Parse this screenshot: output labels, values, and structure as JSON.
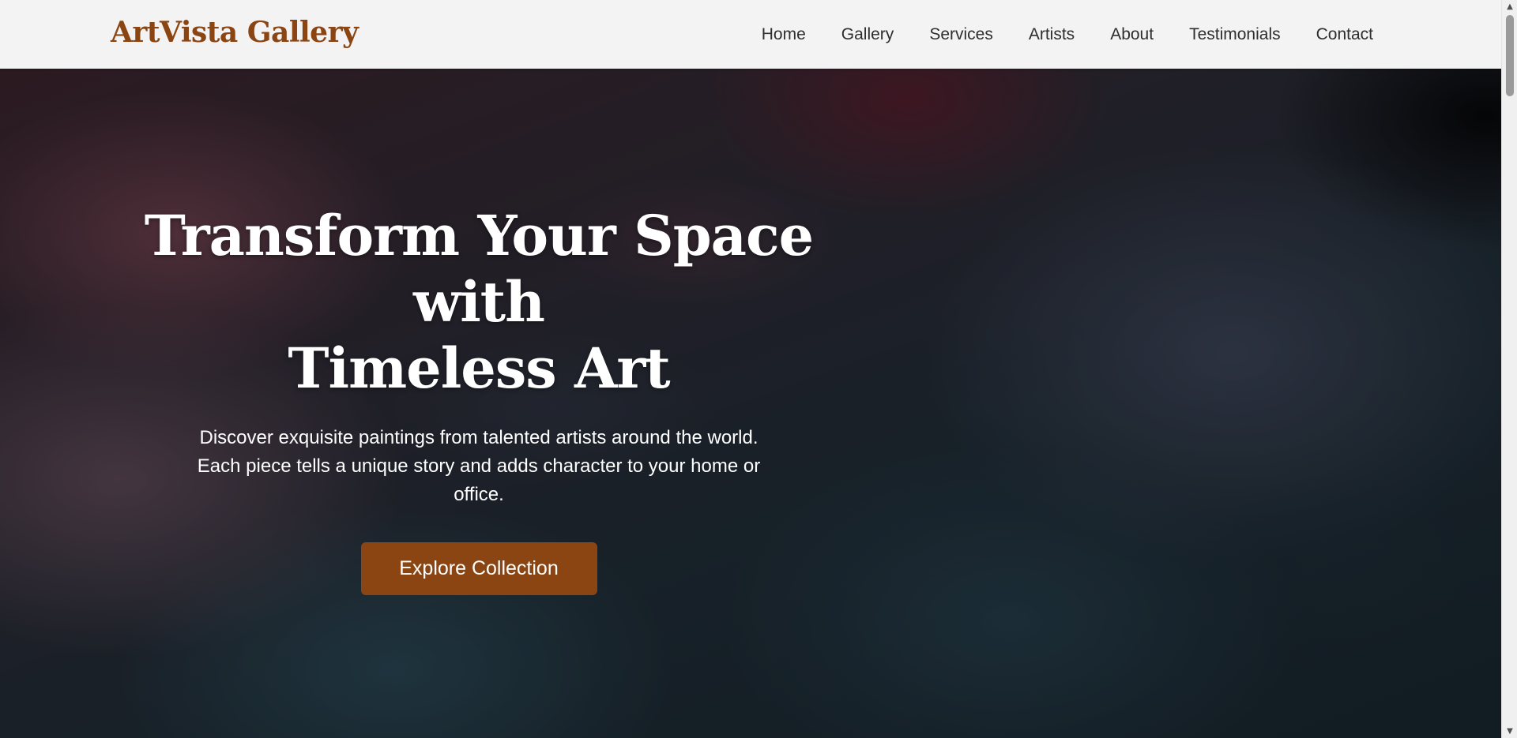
{
  "brand": {
    "name": "ArtVista Gallery",
    "color": "#8b4513"
  },
  "nav": {
    "links": [
      {
        "label": "Home"
      },
      {
        "label": "Gallery"
      },
      {
        "label": "Services"
      },
      {
        "label": "Artists"
      },
      {
        "label": "About"
      },
      {
        "label": "Testimonials"
      },
      {
        "label": "Contact"
      }
    ]
  },
  "hero": {
    "title_line1": "Transform Your Space with",
    "title_line2": "Timeless Art",
    "subtitle": "Discover exquisite paintings from talented artists around the world. Each piece tells a unique story and adds character to your home or office.",
    "cta_label": "Explore Collection",
    "cta_color": "#8b4513",
    "background_image": "abstract-ink-swirl-painting"
  },
  "scrollbar": {
    "up_icon": "triangle-up-icon",
    "down_icon": "triangle-down-icon"
  }
}
